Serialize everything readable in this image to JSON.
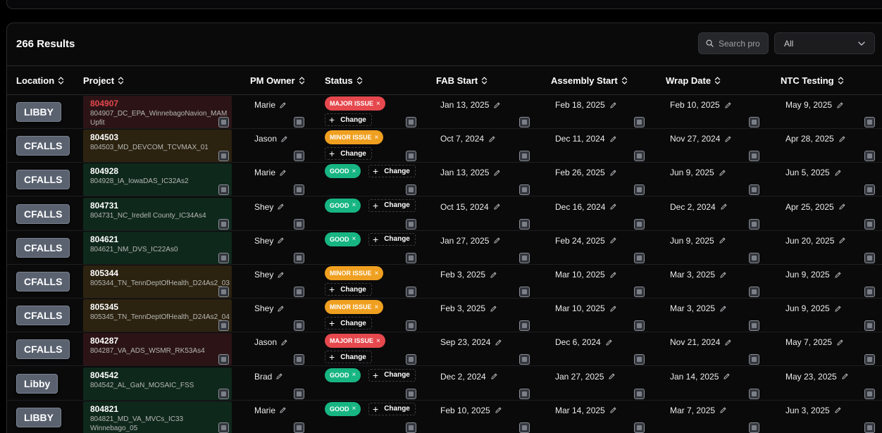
{
  "results_label": "266 Results",
  "search": {
    "placeholder": "Search pro"
  },
  "filter": {
    "selected": "All"
  },
  "columns": [
    "Location",
    "Project",
    "PM Owner",
    "Status",
    "FAB Start",
    "Assembly Start",
    "Wrap Date",
    "NTC Testing"
  ],
  "change_label": "Change",
  "colors": {
    "major": "#e5484d",
    "minor": "#f0a020",
    "good": "#17b582",
    "location_button": "#5a6270"
  },
  "rows": [
    {
      "location": "LIBBY",
      "project_num": "804907",
      "project_desc": "804907_DC_EPA_WinnebagoNavion_MAM Upfit",
      "pm": "Marie",
      "status": "MAJOR ISSUE",
      "fab": "Jan 13, 2025",
      "assembly": "Feb 18, 2025",
      "wrap": "Feb 10, 2025",
      "ntc": "May 9, 2025"
    },
    {
      "location": "CFALLS",
      "project_num": "804503",
      "project_desc": "804503_MD_DEVCOM_TCVMAX_01",
      "pm": "Jason",
      "status": "MINOR ISSUE",
      "fab": "Oct 7, 2024",
      "assembly": "Dec 11, 2024",
      "wrap": "Nov 27, 2024",
      "ntc": "Apr 28, 2025"
    },
    {
      "location": "CFALLS",
      "project_num": "804928",
      "project_desc": "804928_IA_IowaDAS_IC32As2",
      "pm": "Marie",
      "status": "GOOD",
      "fab": "Jan 13, 2025",
      "assembly": "Feb 26, 2025",
      "wrap": "Jun 9, 2025",
      "ntc": "Jun 5, 2025"
    },
    {
      "location": "CFALLS",
      "project_num": "804731",
      "project_desc": "804731_NC_Iredell County_IC34As4",
      "pm": "Shey",
      "status": "GOOD",
      "fab": "Oct 15, 2024",
      "assembly": "Dec 16, 2024",
      "wrap": "Dec 2, 2024",
      "ntc": "Apr 25, 2025"
    },
    {
      "location": "CFALLS",
      "project_num": "804621",
      "project_desc": "804621_NM_DVS_IC22As0",
      "pm": "Shey",
      "status": "GOOD",
      "fab": "Jan 27, 2025",
      "assembly": "Feb 24, 2025",
      "wrap": "Jun 9, 2025",
      "ntc": "Jun 20, 2025"
    },
    {
      "location": "CFALLS",
      "project_num": "805344",
      "project_desc": "805344_TN_TennDeptOfHealth_D24As2_03",
      "pm": "Shey",
      "status": "MINOR ISSUE",
      "fab": "Feb 3, 2025",
      "assembly": "Mar 10, 2025",
      "wrap": "Mar 3, 2025",
      "ntc": "Jun 9, 2025"
    },
    {
      "location": "CFALLS",
      "project_num": "805345",
      "project_desc": "805345_TN_TennDeptOfHealth_D24As2_04",
      "pm": "Shey",
      "status": "MINOR ISSUE",
      "fab": "Feb 3, 2025",
      "assembly": "Mar 10, 2025",
      "wrap": "Mar 3, 2025",
      "ntc": "Jun 9, 2025"
    },
    {
      "location": "CFALLS",
      "project_num": "804287",
      "project_desc": "804287_VA_ADS_WSMR_RK53As4",
      "pm": "Jason",
      "status": "MAJOR ISSUE",
      "fab": "Sep 23, 2024",
      "assembly": "Dec 6, 2024",
      "wrap": "Nov 21, 2024",
      "ntc": "May 7, 2025"
    },
    {
      "location": "Libby",
      "project_num": "804542",
      "project_desc": "804542_AL_GaN_MOSAIC_FSS",
      "pm": "Brad",
      "status": "GOOD",
      "fab": "Dec 2, 2024",
      "assembly": "Jan 27, 2025",
      "wrap": "Jan 14, 2025",
      "ntc": "May 23, 2025"
    },
    {
      "location": "LIBBY",
      "project_num": "804821",
      "project_desc": "804821_MD_VA_MVCs_IC33 Winnebago_05",
      "pm": "Marie",
      "status": "GOOD",
      "fab": "Feb 10, 2025",
      "assembly": "Mar 14, 2025",
      "wrap": "Mar 7, 2025",
      "ntc": "Jun 3, 2025"
    }
  ]
}
